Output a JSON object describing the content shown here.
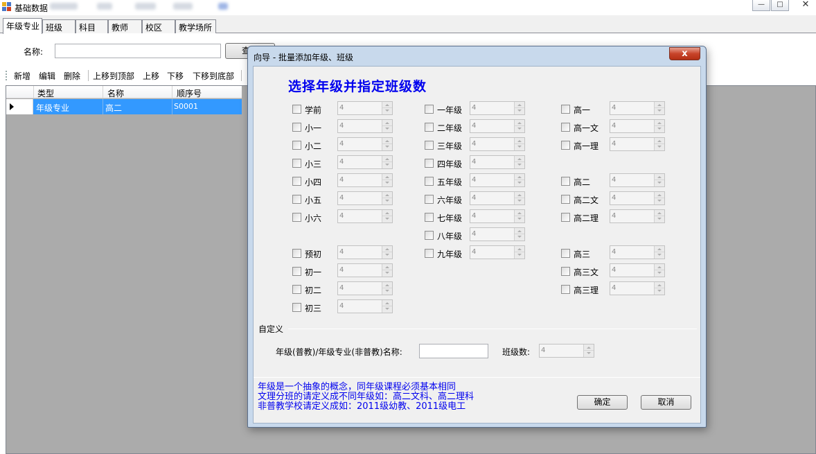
{
  "window": {
    "title": "基础数据",
    "minimize": "—",
    "maximize": "□",
    "close": "✕"
  },
  "tabs": [
    "年级专业",
    "班级",
    "科目",
    "教师",
    "校区",
    "教学场所"
  ],
  "search": {
    "label": "名称:",
    "value": "",
    "button": "查询"
  },
  "toolbar": [
    "新增",
    "编辑",
    "删除",
    "上移到顶部",
    "上移",
    "下移",
    "下移到底部"
  ],
  "grid": {
    "columns": [
      "类型",
      "名称",
      "顺序号"
    ],
    "rows": [
      [
        "年级专业",
        "高二",
        "S0001"
      ]
    ]
  },
  "dialog": {
    "title": "向导 - 批量添加年级、班级",
    "close": "x",
    "heading": "选择年级并指定班级数",
    "default_count": "4",
    "col1": [
      "学前",
      "小一",
      "小二",
      "小三",
      "小四",
      "小五",
      "小六",
      "预初",
      "初一",
      "初二",
      "初三"
    ],
    "col2": [
      "一年级",
      "二年级",
      "三年级",
      "四年级",
      "五年级",
      "六年级",
      "七年级",
      "八年级",
      "九年级"
    ],
    "col3": [
      "高一",
      "高一文",
      "高一理",
      "高二",
      "高二文",
      "高二理",
      "高三",
      "高三文",
      "高三理"
    ],
    "custom_group": "自定义",
    "custom_name_label": "年级(普教)/年级专业(非普教)名称:",
    "custom_name_value": "",
    "class_count_label": "班级数:",
    "class_count_value": "4",
    "notes": [
      "年级是一个抽象的概念，同年级课程必须基本相同",
      "文理分班的请定义成不同年级如：高二文科、高二理科",
      "非普教学校请定义成如：2011级幼教、2011级电工"
    ],
    "ok": "确定",
    "cancel": "取消"
  }
}
